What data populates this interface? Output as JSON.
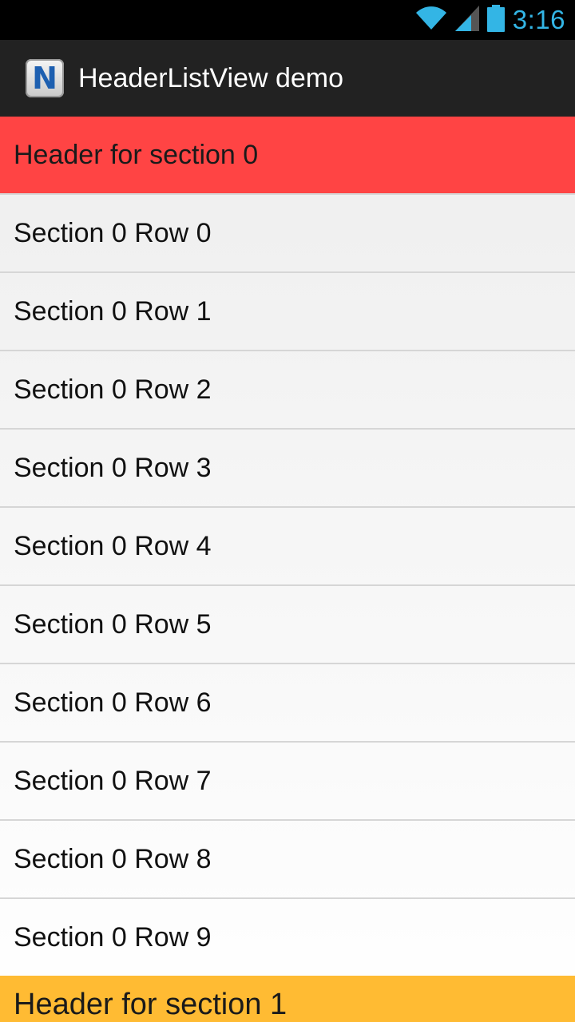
{
  "status_bar": {
    "time": "3:16",
    "icons": [
      "wifi-icon",
      "signal-icon",
      "battery-icon"
    ]
  },
  "action_bar": {
    "icon_letter": "N",
    "title": "HeaderListView demo"
  },
  "sections": [
    {
      "header": "Header for section 0",
      "color": "#ff4444",
      "rows": [
        "Section 0 Row 0",
        "Section 0 Row 1",
        "Section 0 Row 2",
        "Section 0 Row 3",
        "Section 0 Row 4",
        "Section 0 Row 5",
        "Section 0 Row 6",
        "Section 0 Row 7",
        "Section 0 Row 8",
        "Section 0 Row 9"
      ]
    },
    {
      "header": "Header for section 1",
      "color": "#ffbb33",
      "rows": []
    }
  ]
}
